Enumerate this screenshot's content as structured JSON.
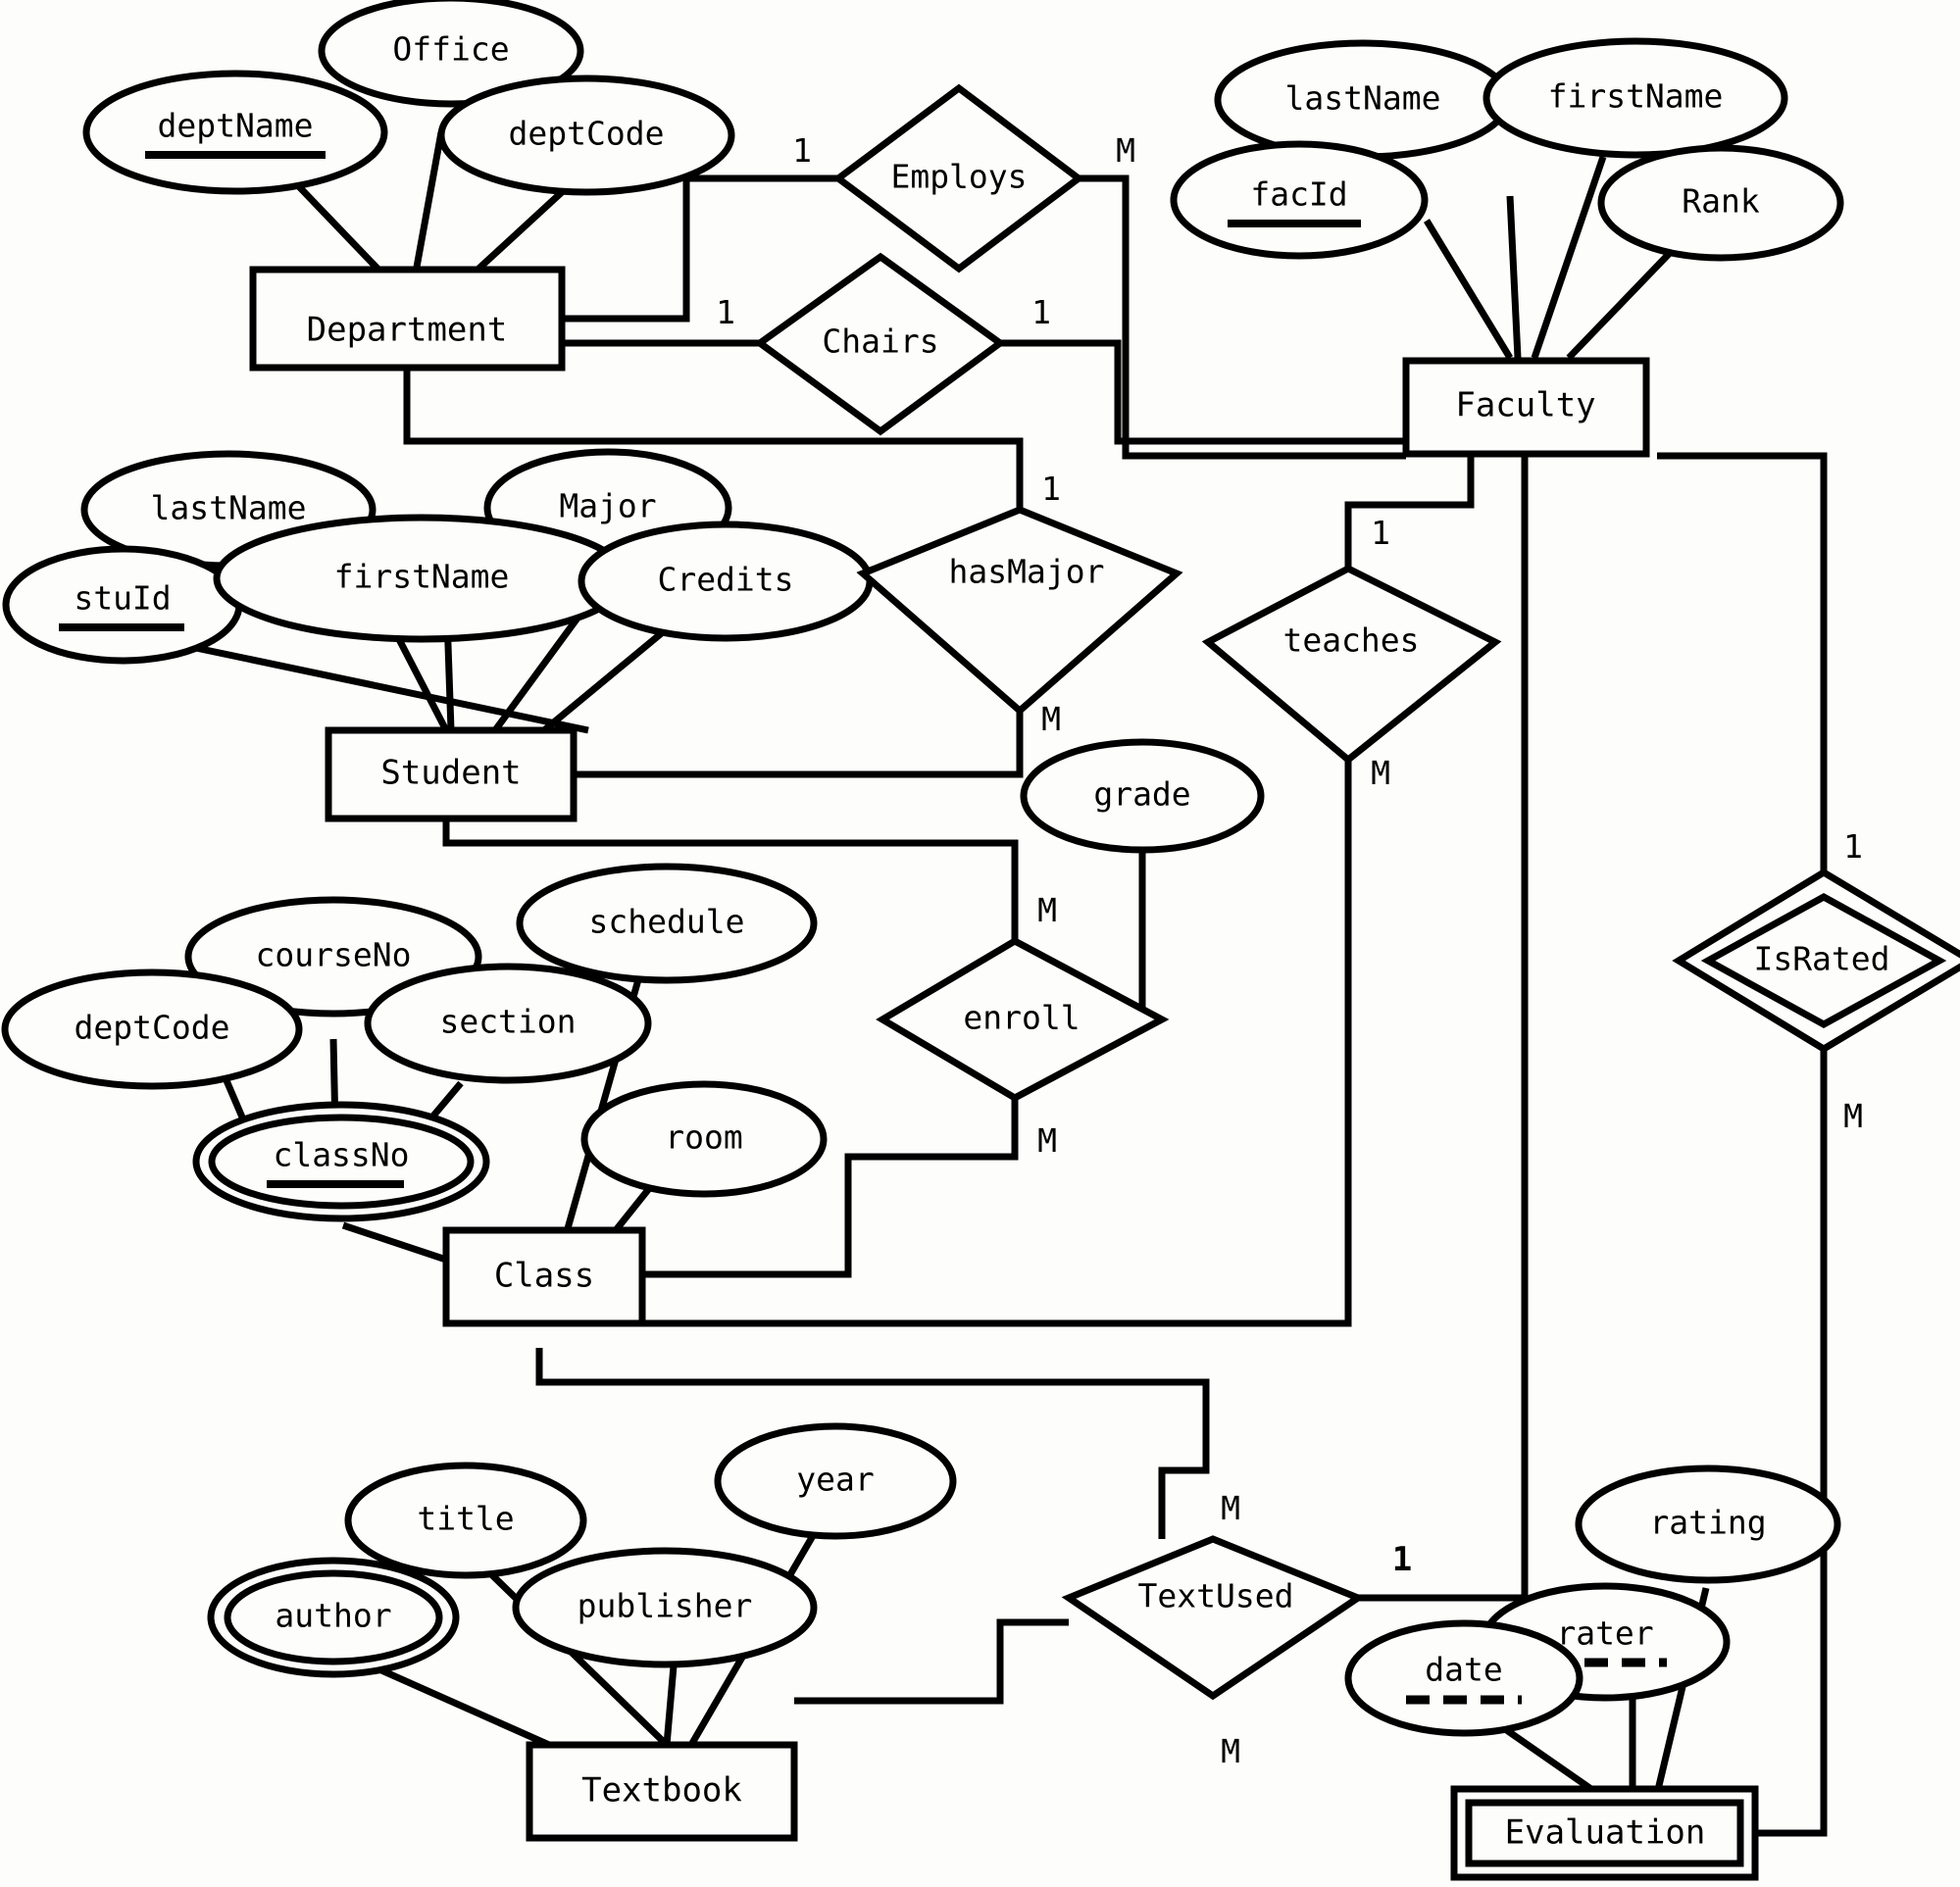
{
  "diagram": {
    "title": "University ER Diagram",
    "notation": "Chen",
    "stroke_color": "#000000",
    "background_color": "#fdfdfb"
  },
  "entities": [
    {
      "id": "department",
      "label": "Department",
      "type": "strong"
    },
    {
      "id": "faculty",
      "label": "Faculty",
      "type": "strong"
    },
    {
      "id": "student",
      "label": "Student",
      "type": "strong"
    },
    {
      "id": "class",
      "label": "Class",
      "type": "strong"
    },
    {
      "id": "textbook",
      "label": "Textbook",
      "type": "strong"
    },
    {
      "id": "evaluation",
      "label": "Evaluation",
      "type": "weak"
    }
  ],
  "relationships": [
    {
      "id": "employs",
      "label": "Employs",
      "type": "normal",
      "left_card": "1",
      "right_card": "M"
    },
    {
      "id": "chairs",
      "label": "Chairs",
      "type": "normal",
      "left_card": "1",
      "right_card": "1"
    },
    {
      "id": "hasmajor",
      "label": "hasMajor",
      "type": "normal",
      "left_card": "1",
      "right_card": "M"
    },
    {
      "id": "teaches",
      "label": "teaches",
      "type": "normal",
      "left_card": "1",
      "right_card": "M"
    },
    {
      "id": "enroll",
      "label": "enroll",
      "type": "normal",
      "left_card": "M",
      "right_card": "M"
    },
    {
      "id": "textused",
      "label": "TextUsed",
      "type": "normal",
      "left_card": "M",
      "right_card": "1"
    },
    {
      "id": "israted",
      "label": "IsRated",
      "type": "identifying",
      "left_card": "1",
      "right_card": "M"
    }
  ],
  "attributes": {
    "department": [
      {
        "label": "deptName",
        "key": "primary",
        "shape": "ellipse"
      },
      {
        "label": "Office",
        "key": "none",
        "shape": "ellipse"
      },
      {
        "label": "deptCode",
        "key": "none",
        "shape": "ellipse"
      }
    ],
    "faculty": [
      {
        "label": "lastName",
        "key": "none",
        "shape": "ellipse"
      },
      {
        "label": "firstName",
        "key": "none",
        "shape": "ellipse"
      },
      {
        "label": "facId",
        "key": "primary",
        "shape": "ellipse"
      },
      {
        "label": "Rank",
        "key": "none",
        "shape": "ellipse"
      }
    ],
    "student": [
      {
        "label": "lastName",
        "key": "none",
        "shape": "ellipse"
      },
      {
        "label": "Major",
        "key": "none",
        "shape": "ellipse"
      },
      {
        "label": "stuId",
        "key": "primary",
        "shape": "ellipse"
      },
      {
        "label": "firstName",
        "key": "none",
        "shape": "ellipse"
      },
      {
        "label": "Credits",
        "key": "none",
        "shape": "ellipse"
      }
    ],
    "class": [
      {
        "label": "courseNo",
        "key": "none",
        "shape": "ellipse"
      },
      {
        "label": "schedule",
        "key": "none",
        "shape": "ellipse"
      },
      {
        "label": "deptCode",
        "key": "none",
        "shape": "ellipse"
      },
      {
        "label": "section",
        "key": "none",
        "shape": "ellipse"
      },
      {
        "label": "classNo",
        "key": "primary",
        "shape": "double-ellipse"
      },
      {
        "label": "room",
        "key": "none",
        "shape": "ellipse"
      }
    ],
    "textbook": [
      {
        "label": "title",
        "key": "none",
        "shape": "ellipse"
      },
      {
        "label": "year",
        "key": "none",
        "shape": "ellipse"
      },
      {
        "label": "author",
        "key": "none",
        "shape": "double-ellipse"
      },
      {
        "label": "publisher",
        "key": "none",
        "shape": "ellipse"
      }
    ],
    "evaluation": [
      {
        "label": "rating",
        "key": "none",
        "shape": "ellipse"
      },
      {
        "label": "rater",
        "key": "partial",
        "shape": "ellipse"
      },
      {
        "label": "date",
        "key": "partial",
        "shape": "ellipse"
      }
    ],
    "enroll": [
      {
        "label": "grade",
        "key": "none",
        "shape": "ellipse"
      }
    ]
  },
  "cardinality_labels": {
    "employs_left": "1",
    "employs_right": "M",
    "chairs_left": "1",
    "chairs_right": "1",
    "hasmajor_top": "1",
    "hasmajor_bottom": "M",
    "teaches_top": "1",
    "teaches_bottom": "M",
    "enroll_top": "M",
    "enroll_bottom": "M",
    "israted_top": "1",
    "israted_bottom": "M",
    "textused_top": "M",
    "textused_right": "1",
    "textused_bottom": "M"
  }
}
